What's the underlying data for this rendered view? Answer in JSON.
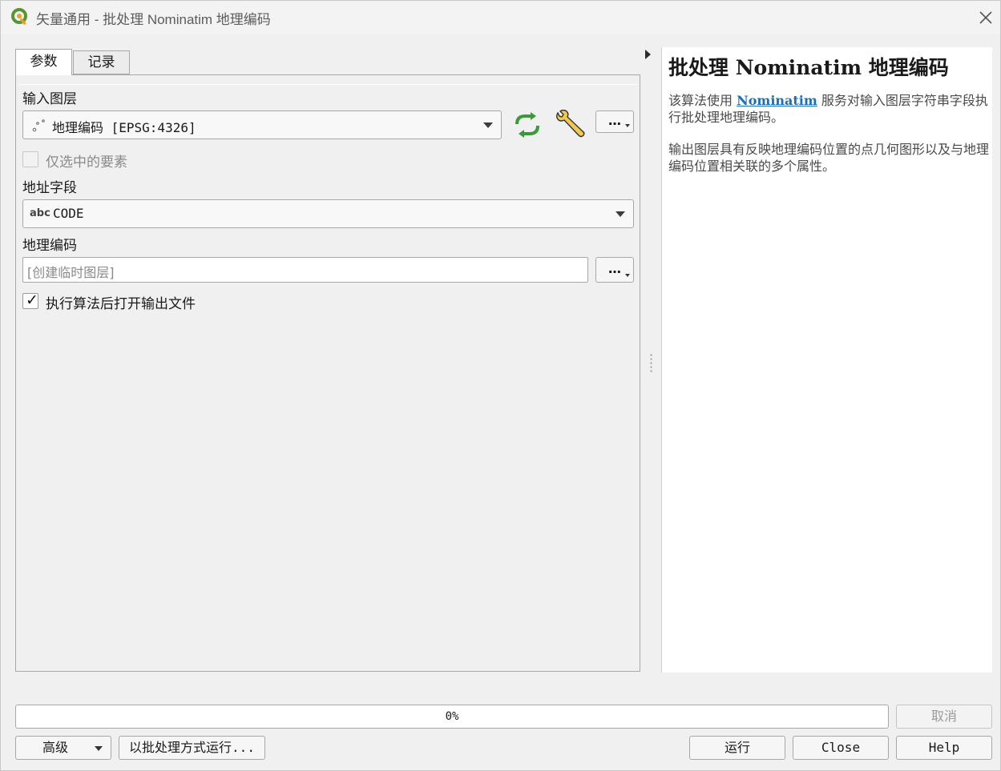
{
  "window": {
    "title": "矢量通用 - 批处理 Nominatim 地理编码"
  },
  "tabs": [
    {
      "label": "参数",
      "active": true
    },
    {
      "label": "记录",
      "active": false
    }
  ],
  "params": {
    "input_layer_label": "输入图层",
    "input_layer_value": "地理编码 [EPSG:4326]",
    "selected_only_label": "仅选中的要素",
    "selected_only_checked": false,
    "address_field_label": "地址字段",
    "address_field_type": "abc",
    "address_field_value": "CODE",
    "geocode_label": "地理编码",
    "geocode_placeholder": "[创建临时图层]",
    "open_output_label": "执行算法后打开输出文件",
    "open_output_checked": true,
    "more_label": "…"
  },
  "help": {
    "title": "批处理 Nominatim 地理编码",
    "p1_before": "该算法使用 ",
    "p1_link": "Nominatim",
    "p1_after": " 服务对输入图层字符串字段执行批处理地理编码。",
    "p2": "输出图层具有反映地理编码位置的点几何图形以及与地理编码位置相关联的多个属性。"
  },
  "bottom": {
    "progress_text": "0%",
    "progress_value": 0,
    "cancel_label": "取消",
    "advanced_label": "高级",
    "batch_label": "以批处理方式运行...",
    "run_label": "运行",
    "close_label": "Close",
    "help_label": "Help"
  },
  "colors": {
    "accent": "#1a6fb8",
    "refresh_icon": "#3a9a3a",
    "qgis_green": "#589632",
    "qgis_yellow": "#ee9e2e"
  }
}
